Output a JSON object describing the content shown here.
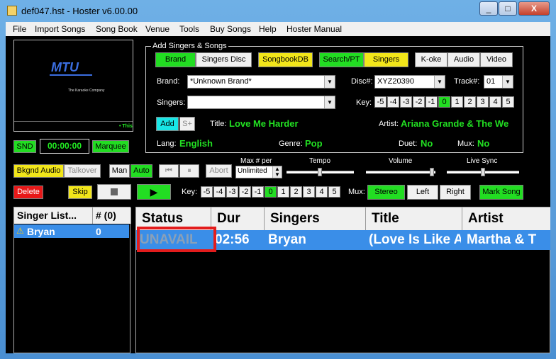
{
  "window": {
    "title": "def047.hst - Hoster v6.00.00",
    "minimize": "_",
    "maximize": "□",
    "close": "X"
  },
  "menu": [
    "File",
    "Import Songs",
    "Song Book",
    "Venue",
    "Tools",
    "Buy Songs",
    "Help",
    "Hoster Manual"
  ],
  "video": {
    "logo_text": "MTU",
    "company": "The Karaoke Company",
    "caption": "• This",
    "snd": "SND",
    "time": "00:00:00",
    "marquee": "Marquee"
  },
  "add_panel": {
    "legend": "Add Singers & Songs",
    "tabs": [
      "Brand",
      "Singers Disc",
      "SongbookDB",
      "Search/PT",
      "Singers",
      "K-oke",
      "Audio",
      "Video"
    ],
    "brand_label": "Brand:",
    "brand_value": "*Unknown Brand*",
    "disc_label": "Disc#:",
    "disc_value": "XYZ20390",
    "track_label": "Track#:",
    "track_value": "01",
    "singers_label": "Singers:",
    "singers_value": "",
    "key_label": "Key:",
    "keys": [
      "-5",
      "-4",
      "-3",
      "-2",
      "-1",
      "0",
      "1",
      "2",
      "3",
      "4",
      "5"
    ],
    "add": "Add",
    "splus": "S+",
    "title_label": "Title:",
    "title_value": "Love Me Harder",
    "artist_label": "Artist:",
    "artist_value": "Ariana Grande & The We",
    "lang_label": "Lang:",
    "lang_value": "English",
    "genre_label": "Genre:",
    "genre_value": "Pop",
    "duet_label": "Duet:",
    "duet_value": "No",
    "mux_label": "Mux:",
    "mux_value": "No"
  },
  "controls": {
    "bkgnd_audio": "Bkgnd Audio",
    "talkover": "Talkover",
    "man": "Man",
    "auto": "Auto",
    "abort": "Abort",
    "max_per_label": "Max # per",
    "max_per_value": "Unlimited",
    "tempo": "Tempo",
    "volume": "Volume",
    "live_sync": "Live Sync",
    "delete": "Delete",
    "skip": "Skip",
    "key_label": "Key:",
    "keys": [
      "-5",
      "-4",
      "-3",
      "-2",
      "-1",
      "0",
      "1",
      "2",
      "3",
      "4",
      "5"
    ],
    "mux_label": "Mux:",
    "stereo": "Stereo",
    "left": "Left",
    "right": "Right",
    "mark_song": "Mark Song"
  },
  "singer_list": {
    "headers": [
      "Singer List...",
      "# (0)"
    ],
    "rows": [
      {
        "name": "Bryan",
        "count": "0"
      }
    ]
  },
  "queue": {
    "headers": [
      "Status",
      "Dur",
      "Singers",
      "Title",
      "Artist"
    ],
    "rows": [
      {
        "status": "UNAVAIL",
        "dur": "02:56",
        "singer": "Bryan",
        "title": "(Love Is Like A",
        "artist": "Martha & T"
      }
    ]
  },
  "colors": {
    "green": "#22dd22",
    "yellow": "#f2e61a",
    "cyan": "#18e6e6",
    "red": "#e81818",
    "highlight": "#e31c1c",
    "row_selected": "#3a8ee8"
  }
}
